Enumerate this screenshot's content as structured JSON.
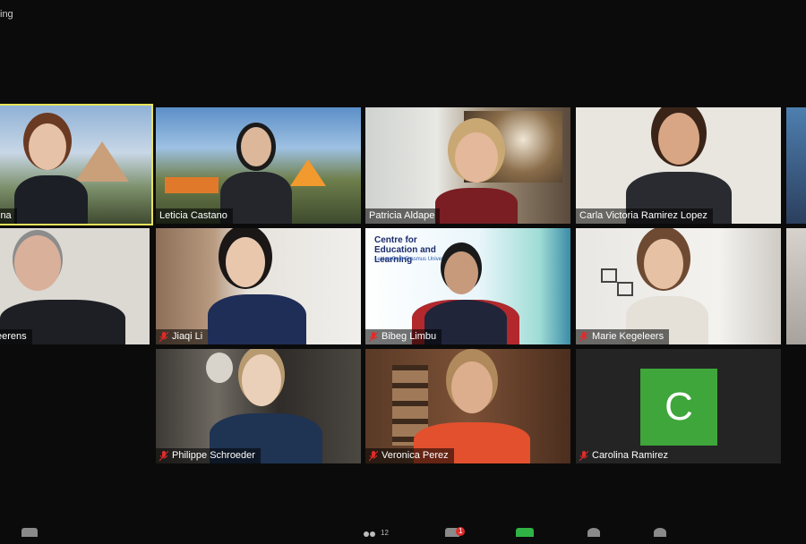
{
  "meeting": {
    "status_text": "ing"
  },
  "participants": [
    {
      "name": "ina",
      "muted": false,
      "active_speaker": true
    },
    {
      "name": "Leticia Castano",
      "muted": false
    },
    {
      "name": "Patricia Aldape",
      "muted": false
    },
    {
      "name": "Carla Victoria Ramirez Lopez",
      "muted": false
    },
    {
      "name": "eerens",
      "muted": false
    },
    {
      "name": "Jiaqi Li",
      "muted": true
    },
    {
      "name": "Bibeg Limbu",
      "muted": true,
      "slide_title": "Centre for Education and Learning",
      "slide_subtitle": "Leiden-Delft-Erasmus Universities"
    },
    {
      "name": "Marie Kegeleers",
      "muted": true
    },
    {
      "name": "Philippe Schroeder",
      "muted": true
    },
    {
      "name": "Veronica Perez",
      "muted": true
    },
    {
      "name": "Carolina Ramirez",
      "muted": true,
      "avatar_letter": "C"
    }
  ],
  "toolbar": {
    "participants_count": "12",
    "chat_badge": "1"
  },
  "colors": {
    "active_border": "#e8e35a",
    "avatar_bg": "#3ea63a",
    "muted_icon": "#e02b2b"
  }
}
